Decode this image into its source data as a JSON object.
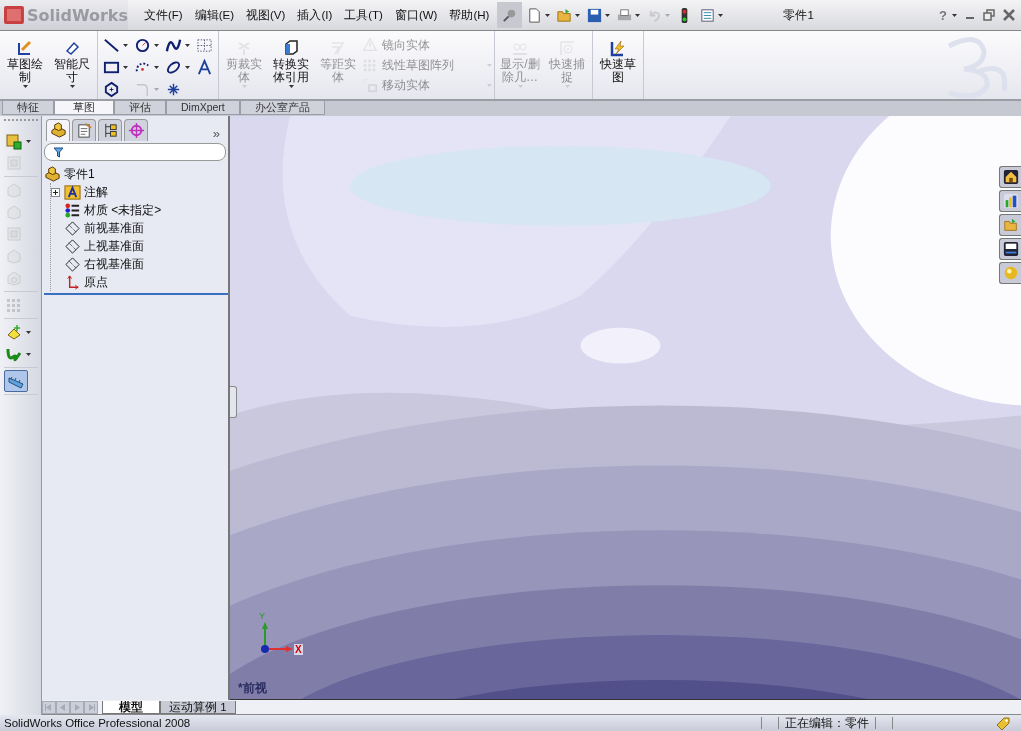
{
  "title_bar": {
    "logo": "SolidWorks",
    "menu": [
      "文件(F)",
      "编辑(E)",
      "视图(V)",
      "插入(I)",
      "工具(T)",
      "窗口(W)",
      "帮助(H)"
    ],
    "quick_tools": [
      {
        "kind": "pin",
        "dropdown": false,
        "disabled": false
      },
      {
        "kind": "new",
        "dropdown": true,
        "disabled": false
      },
      {
        "kind": "open",
        "dropdown": true,
        "disabled": false
      },
      {
        "kind": "save",
        "dropdown": true,
        "disabled": false
      },
      {
        "kind": "print",
        "dropdown": true,
        "disabled": false
      },
      {
        "kind": "undo",
        "dropdown": true,
        "disabled": true
      },
      {
        "kind": "traffic-light",
        "dropdown": false,
        "disabled": false
      },
      {
        "kind": "options",
        "dropdown": true,
        "disabled": false
      }
    ],
    "document_title": "零件1",
    "help": "?"
  },
  "ribbon": [
    [
      {
        "kind": "sketch",
        "label": "草图绘制",
        "disabled": false,
        "dropdown": true
      },
      {
        "kind": "dimension",
        "label": "智能尺寸",
        "disabled": false,
        "dropdown": true
      }
    ],
    [
      {
        "tools": [
          {
            "kind": "line",
            "dropdown": true,
            "disabled": false
          },
          {
            "kind": "circle",
            "dropdown": true,
            "disabled": false
          },
          {
            "kind": "spline",
            "dropdown": true,
            "disabled": false
          },
          {
            "kind": "grid",
            "dropdown": false,
            "disabled": false
          },
          {
            "kind": "rect",
            "dropdown": true,
            "disabled": false
          },
          {
            "kind": "arc",
            "dropdown": true,
            "disabled": false
          },
          {
            "kind": "ellipse",
            "dropdown": true,
            "disabled": false
          },
          {
            "kind": "text",
            "dropdown": false,
            "disabled": false
          },
          {
            "kind": "polygon",
            "dropdown": false,
            "disabled": false
          },
          {
            "kind": "fillet",
            "dropdown": true,
            "disabled": true
          },
          {
            "kind": "point",
            "dropdown": false,
            "disabled": false
          }
        ]
      }
    ],
    [
      {
        "kind": "trim",
        "label": "剪裁实体",
        "disabled": true,
        "dropdown": true
      },
      {
        "kind": "convert",
        "label": "转换实体引用",
        "disabled": false,
        "dropdown": true
      },
      {
        "kind": "offset",
        "label": "等距实体",
        "disabled": true,
        "dropdown": false
      },
      {
        "items": [
          {
            "kind": "mirror",
            "label": "镜向实体",
            "disabled": true,
            "dropdown": false
          },
          {
            "kind": "pattern",
            "label": "线性草图阵列",
            "disabled": true,
            "dropdown": true
          },
          {
            "kind": "move",
            "label": "移动实体",
            "disabled": true,
            "dropdown": true
          }
        ]
      }
    ],
    [
      {
        "kind": "relations",
        "label": "显示/删除几…",
        "disabled": true,
        "dropdown": true
      },
      {
        "kind": "snap",
        "label": "快速捕捉",
        "disabled": true,
        "dropdown": true
      }
    ],
    [
      {
        "kind": "quick-sketch",
        "label": "快速草图",
        "disabled": false,
        "dropdown": false
      }
    ]
  ],
  "command_tabs": [
    {
      "label": "特征",
      "selected": false
    },
    {
      "label": "草图",
      "selected": true
    },
    {
      "label": "评估",
      "selected": false
    },
    {
      "label": "DimXpert",
      "selected": false
    },
    {
      "label": "办公室产品",
      "selected": false
    }
  ],
  "left_toolbar": [
    [
      {
        "kind": "extrude",
        "disabled": false,
        "dropdown": true,
        "selected": false
      },
      {
        "kind": "boss",
        "disabled": true,
        "dropdown": false,
        "selected": false
      }
    ],
    [
      {
        "kind": "revolve",
        "disabled": true,
        "dropdown": false,
        "selected": false
      },
      {
        "kind": "sweep",
        "disabled": true,
        "dropdown": false,
        "selected": false
      },
      {
        "kind": "shell",
        "disabled": true,
        "dropdown": false,
        "selected": false
      },
      {
        "kind": "loft",
        "disabled": true,
        "dropdown": false,
        "selected": false
      },
      {
        "kind": "hole",
        "disabled": true,
        "dropdown": false,
        "selected": false
      }
    ],
    [
      {
        "kind": "pattern",
        "disabled": true,
        "dropdown": false,
        "selected": false
      }
    ],
    [
      {
        "kind": "reference",
        "disabled": false,
        "dropdown": true,
        "selected": false
      },
      {
        "kind": "curve",
        "disabled": false,
        "dropdown": true,
        "selected": false
      }
    ],
    [
      {
        "kind": "instant3d",
        "disabled": false,
        "dropdown": false,
        "selected": true
      }
    ]
  ],
  "feature_tree": {
    "tabs": [
      {
        "kind": "feature-manager",
        "selected": true
      },
      {
        "kind": "property-manager",
        "selected": false
      },
      {
        "kind": "configuration-manager",
        "selected": false
      },
      {
        "kind": "dim-manager",
        "selected": false
      }
    ],
    "more": "»",
    "root": {
      "label": "零件1",
      "children": [
        {
          "kind": "annotations",
          "label": "注解",
          "expanded": false
        },
        {
          "kind": "material",
          "label": "材质 <未指定>"
        },
        {
          "kind": "plane",
          "label": "前视基准面"
        },
        {
          "kind": "plane",
          "label": "上视基准面"
        },
        {
          "kind": "plane",
          "label": "右视基准面"
        },
        {
          "kind": "origin",
          "label": "原点"
        }
      ]
    }
  },
  "viewport": {
    "view_label": "*前视",
    "triad": {
      "y": "Y",
      "x": "X"
    },
    "task_pane": [
      {
        "kind": "home"
      },
      {
        "kind": "library"
      },
      {
        "kind": "folder"
      },
      {
        "kind": "palette"
      },
      {
        "kind": "appearance"
      }
    ]
  },
  "bottom_tabs": [
    {
      "label": "模型",
      "selected": true
    },
    {
      "label": "运动算例 1",
      "selected": false
    }
  ],
  "status_bar": {
    "product": "SolidWorks Office Professional 2008",
    "editing": "正在编辑：零件"
  }
}
